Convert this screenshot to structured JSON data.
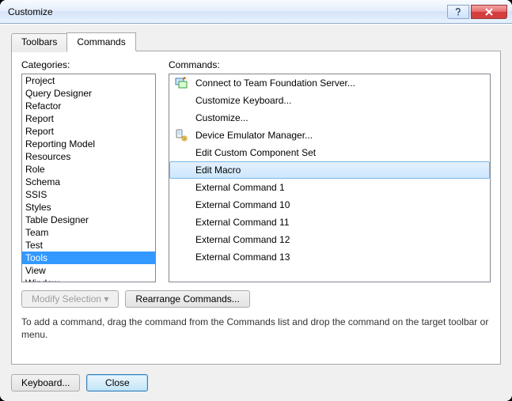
{
  "window": {
    "title": "Customize"
  },
  "tabs": [
    {
      "label": "Toolbars",
      "active": false
    },
    {
      "label": "Commands",
      "active": true
    }
  ],
  "labels": {
    "categories": "Categories:",
    "commands": "Commands:"
  },
  "categories": {
    "selected_index": 14,
    "items": [
      "Project",
      "Query Designer",
      "Refactor",
      "Report",
      "Report",
      "Reporting Model",
      "Resources",
      "Role",
      "Schema",
      "SSIS",
      "Styles",
      "Table Designer",
      "Team",
      "Test",
      "Tools",
      "View",
      "Window"
    ]
  },
  "commands": {
    "selected_index": 5,
    "items": [
      {
        "label": "Connect to Team Foundation Server...",
        "has_icon": true,
        "icon": "tfs-icon"
      },
      {
        "label": "Customize Keyboard...",
        "has_icon": false
      },
      {
        "label": "Customize...",
        "has_icon": false
      },
      {
        "label": "Device Emulator Manager...",
        "has_icon": true,
        "icon": "device-emulator-icon"
      },
      {
        "label": "Edit Custom Component Set",
        "has_icon": false
      },
      {
        "label": "Edit Macro",
        "has_icon": false
      },
      {
        "label": "External Command 1",
        "has_icon": false
      },
      {
        "label": "External Command 10",
        "has_icon": false
      },
      {
        "label": "External Command 11",
        "has_icon": false
      },
      {
        "label": "External Command 12",
        "has_icon": false
      },
      {
        "label": "External Command 13",
        "has_icon": false
      }
    ]
  },
  "buttons": {
    "modify_selection": "Modify Selection ▾",
    "rearrange_commands": "Rearrange Commands...",
    "keyboard": "Keyboard...",
    "close": "Close"
  },
  "help_text": "To add a command, drag the command from the Commands list and drop the command on the target toolbar or menu."
}
